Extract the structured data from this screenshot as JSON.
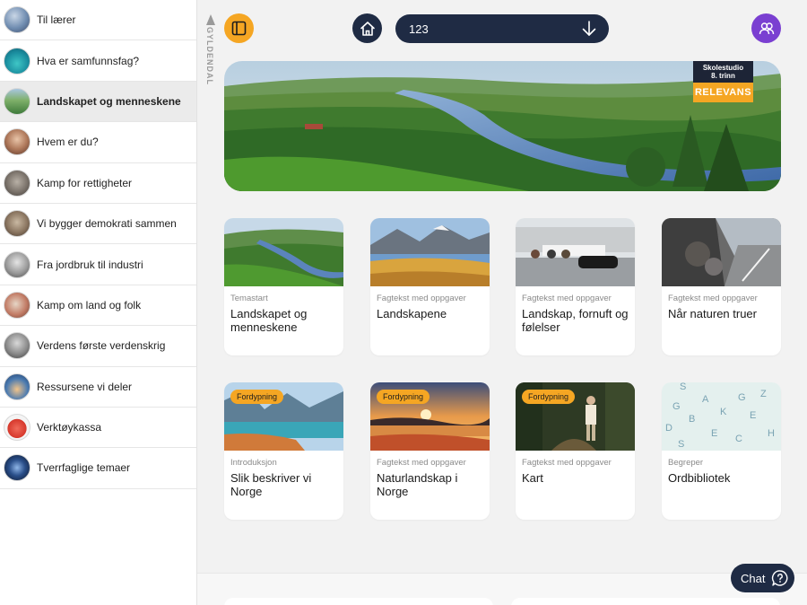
{
  "sidebar": {
    "items": [
      {
        "label": "Til lærer",
        "active": false
      },
      {
        "label": "Hva er samfunnsfag?",
        "active": false
      },
      {
        "label": "Landskapet og menneskene",
        "active": true
      },
      {
        "label": "Hvem er du?",
        "active": false
      },
      {
        "label": "Kamp for rettigheter",
        "active": false
      },
      {
        "label": "Vi bygger demokrati sammen",
        "active": false
      },
      {
        "label": "Fra jordbruk til industri",
        "active": false
      },
      {
        "label": "Kamp om land og folk",
        "active": false
      },
      {
        "label": "Verdens første verdenskrig",
        "active": false
      },
      {
        "label": "Ressursene vi deler",
        "active": false
      },
      {
        "label": "Verktøykassa",
        "active": false
      },
      {
        "label": "Tverrfaglige temaer",
        "active": false
      }
    ]
  },
  "publisher": {
    "name": "GYLDENDAL"
  },
  "topbar": {
    "chapter_value": "123",
    "sidebar_toggle_icon": "sidebar-icon",
    "home_icon": "home-icon",
    "user_icon": "users-icon"
  },
  "hero": {
    "badge_line1": "Skolestudio",
    "badge_line2": "8. trinn",
    "badge_brand": "RELEVANS"
  },
  "cards": [
    {
      "type": "Temastart",
      "title": "Landskapet og menneskene",
      "tag": ""
    },
    {
      "type": "Fagtekst med oppgaver",
      "title": "Landskapene",
      "tag": ""
    },
    {
      "type": "Fagtekst med oppgaver",
      "title": "Landskap, fornuft og følelser",
      "tag": ""
    },
    {
      "type": "Fagtekst med oppgaver",
      "title": "Når naturen truer",
      "tag": ""
    },
    {
      "type": "Introduksjon",
      "title": "Slik beskriver vi Norge",
      "tag": "Fordypning"
    },
    {
      "type": "Fagtekst med oppgaver",
      "title": "Naturlandskap i Norge",
      "tag": "Fordypning"
    },
    {
      "type": "Fagtekst med oppgaver",
      "title": "Kart",
      "tag": "Fordypning"
    },
    {
      "type": "Begreper",
      "title": "Ordbibliotek",
      "tag": ""
    }
  ],
  "chat": {
    "label": "Chat"
  },
  "colors": {
    "accent_orange": "#f5a623",
    "navy": "#1f2b44",
    "purple": "#7a3fd1",
    "sidebar_active_bg": "#ebebeb"
  }
}
